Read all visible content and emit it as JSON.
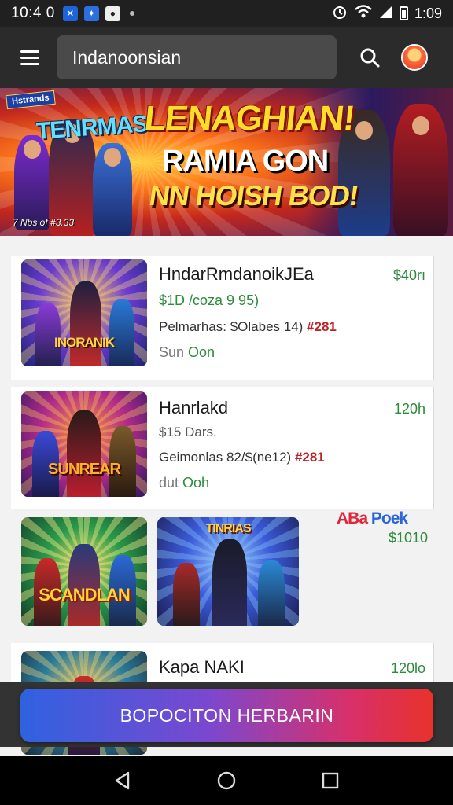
{
  "status_bar": {
    "time_left": "10:4 0",
    "time_right": "1:09"
  },
  "app_bar": {
    "search_value": "Indanoonsian"
  },
  "banner": {
    "badge": "Hstrands",
    "title_left": "TENRMAS",
    "title": "LENAGHIAN!",
    "subtitle1": "RAMIA GON",
    "subtitle2": "NN HOISH BOD!",
    "caption": "7 Nbs of #3.33"
  },
  "items": [
    {
      "title": "HndarRmdanoikJEa",
      "price": "$40rı",
      "meta": "$1D /coza 9 95)",
      "desc": "Pelmarhas: $Olabes 14) ",
      "desc_accent": "#281",
      "status": "Sun ",
      "status_on": "Oon",
      "thumb_logo": "INORANIK"
    },
    {
      "title": "Hanrlakd",
      "price": "120h",
      "meta": "$15 Dars.",
      "desc": "Geimonlas 82/$(ne12) ",
      "desc_accent": "#281",
      "status": "dut ",
      "status_on": "Ooh",
      "thumb_logo": "SUNREAR"
    },
    {
      "promo_a": "ABa",
      "promo_b": "Poek",
      "price": "$1010",
      "thumb1_logo": "SCANDLAN",
      "thumb2_logo": "TINRIAS"
    },
    {
      "title": "Kapa NAKI",
      "price": "120lo"
    }
  ],
  "cta": {
    "label": "BOPOCITON HERBARIN"
  },
  "colors": {
    "accent_green": "#2e8b3c",
    "accent_red": "#c0222a",
    "cta_start": "#2f62e0",
    "cta_end": "#e8322a"
  }
}
